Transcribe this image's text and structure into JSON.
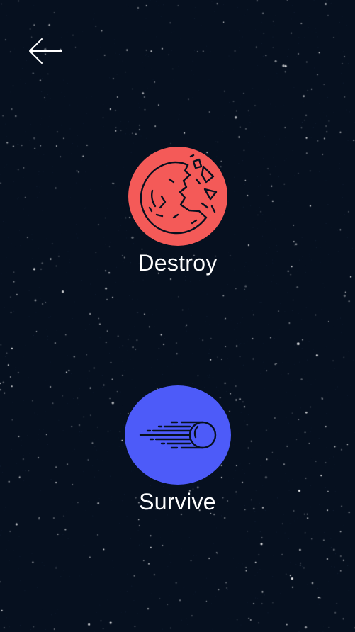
{
  "header": {
    "back_icon": "arrow-left-icon"
  },
  "modes": {
    "destroy": {
      "label": "Destroy",
      "icon": "cracked-planet-icon",
      "color": "#f45a58"
    },
    "survive": {
      "label": "Survive",
      "icon": "comet-icon",
      "color": "#4d5bf9"
    }
  },
  "colors": {
    "background": "#06101f",
    "text": "#ffffff",
    "icon_stroke": "#06101f"
  }
}
